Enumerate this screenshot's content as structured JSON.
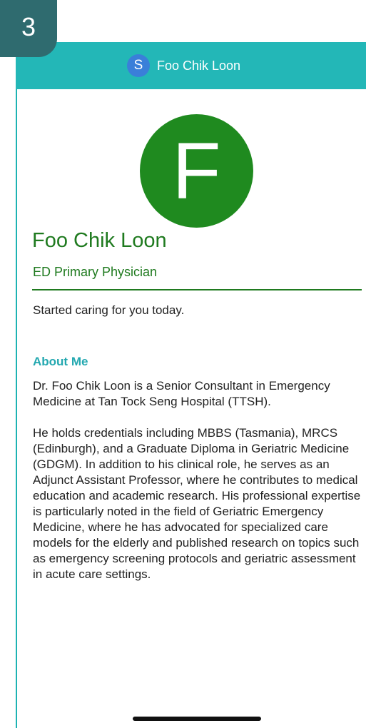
{
  "step_number": "3",
  "header": {
    "avatar_letter": "S",
    "title": "Foo Chik Loon"
  },
  "profile": {
    "avatar_letter": "F",
    "name": "Foo Chik Loon",
    "role": "ED Primary Physician",
    "status": "Started caring for you today."
  },
  "about": {
    "heading": "About Me",
    "paragraph_1": "Dr. Foo Chik Loon is a Senior Consultant in Emergency Medicine at Tan Tock Seng Hospital (TTSH).",
    "paragraph_2": "He holds credentials including MBBS (Tasmania), MRCS (Edinburgh), and a Graduate Diploma in Geriatric Medicine (GDGM). In addition to his clinical role, he serves as an Adjunct Assistant Professor, where he contributes to medical education and academic research. His professional expertise is particularly noted in the field of Geriatric Emergency Medicine, where he has advocated for specialized care models for the elderly and published research on topics such as emergency screening protocols and geriatric assessment in acute care settings."
  },
  "colors": {
    "header_bg": "#23b7b7",
    "header_avatar_bg": "#3a7fd9",
    "profile_green": "#1f8a1f",
    "about_heading": "#23a8b0",
    "step_badge_bg": "#2f6b6f"
  }
}
